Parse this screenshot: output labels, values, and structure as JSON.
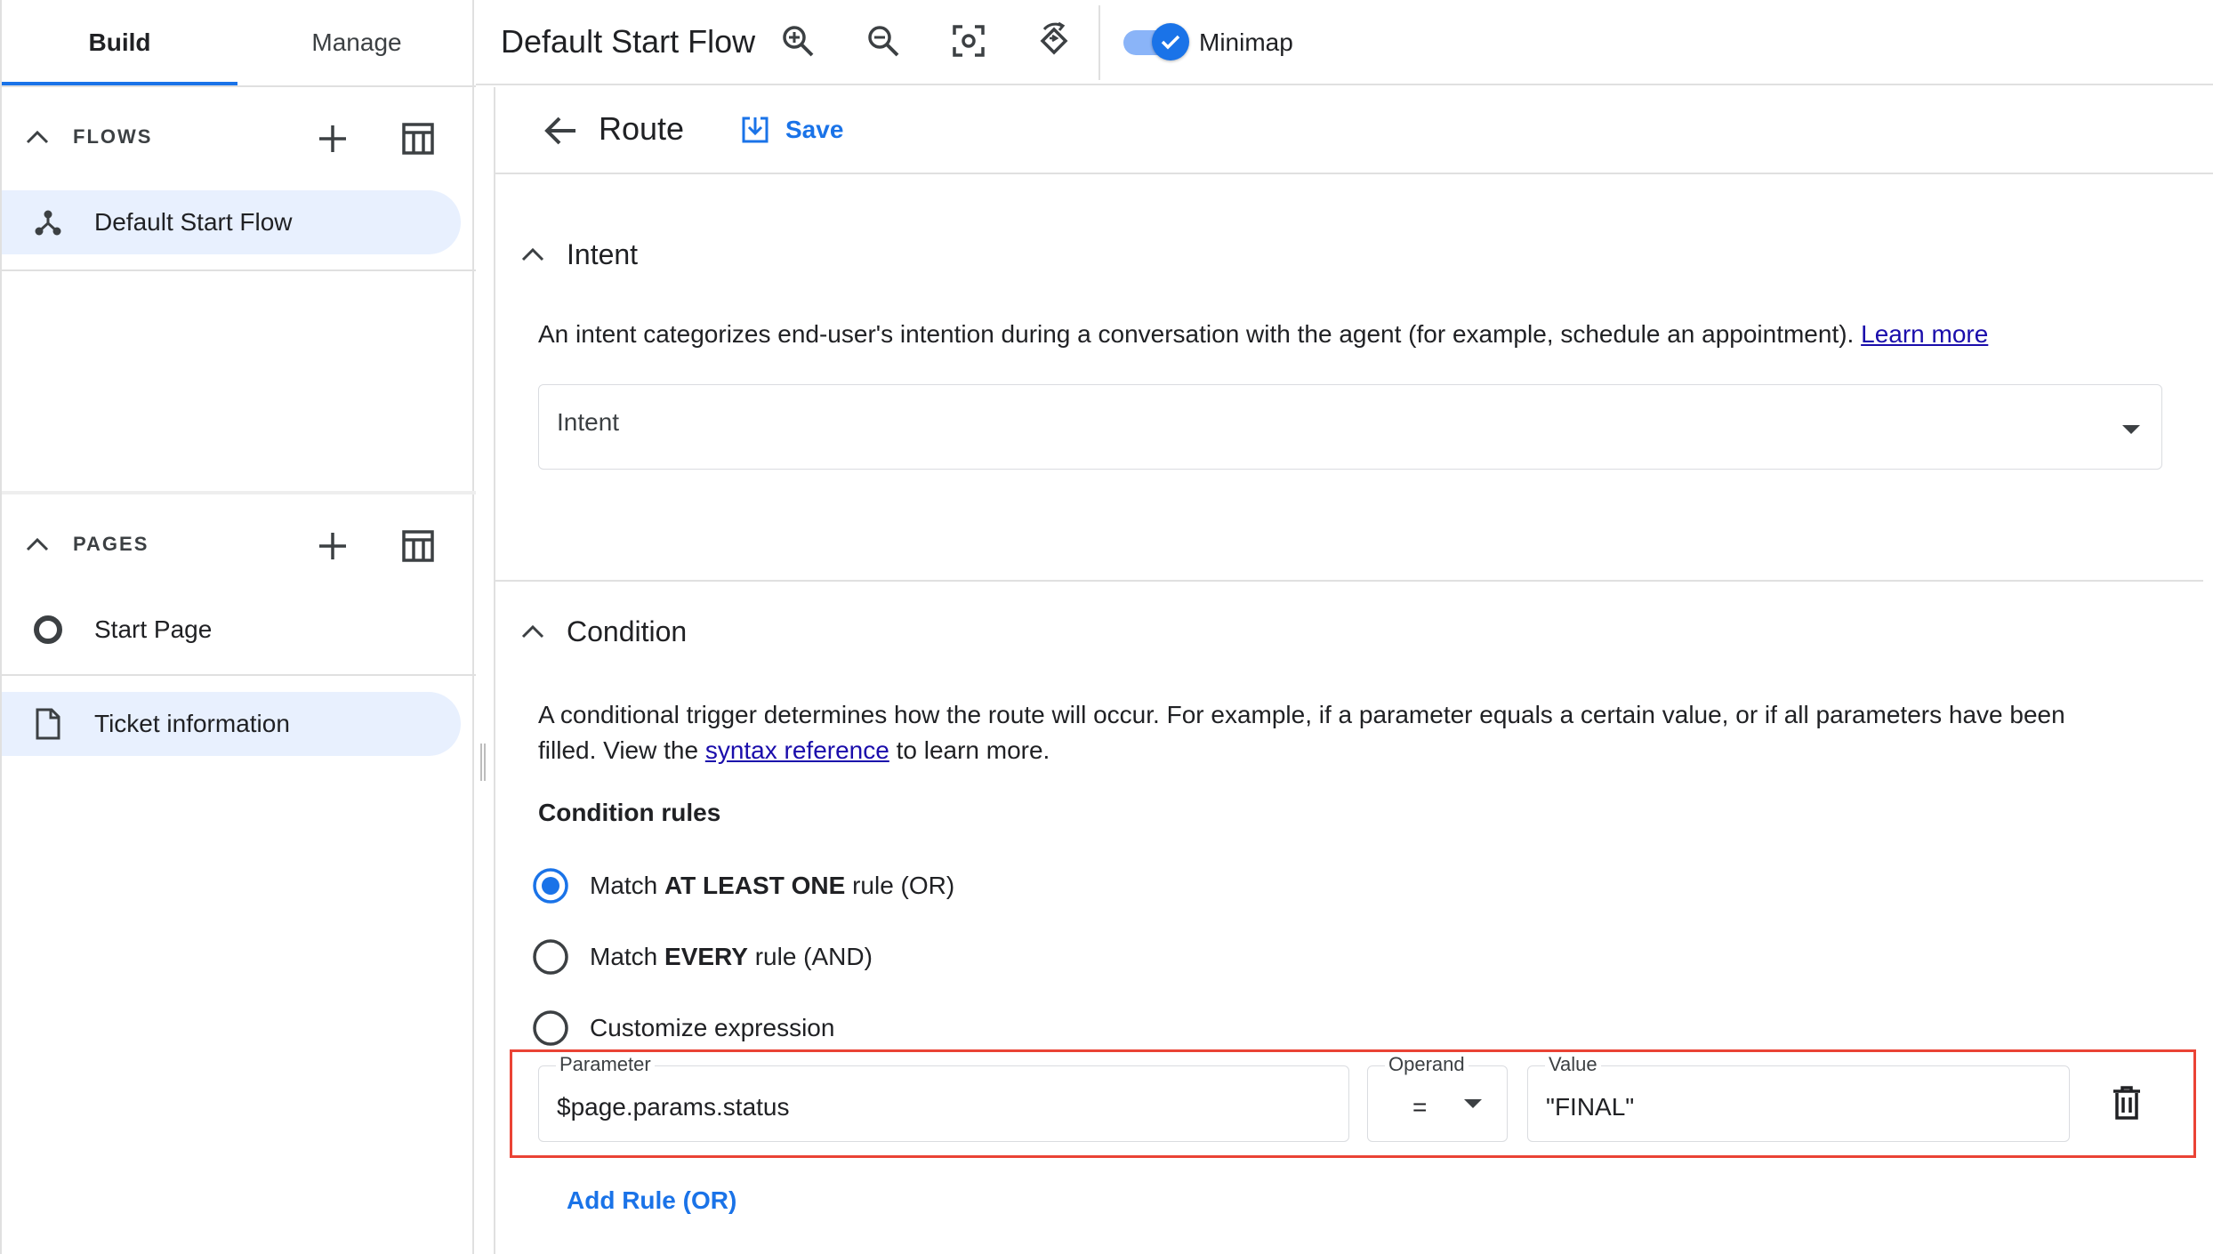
{
  "tabs": {
    "build": "Build",
    "manage": "Manage"
  },
  "toolbar": {
    "flow_title": "Default Start Flow",
    "minimap_label": "Minimap",
    "minimap_on": true,
    "icons": [
      "zoom-in-icon",
      "zoom-out-icon",
      "fit-screen-icon",
      "reset-view-icon"
    ]
  },
  "sidebar": {
    "flows": {
      "header": "FLOWS",
      "items": [
        {
          "label": "Default Start Flow",
          "icon": "flow-icon",
          "selected": true
        }
      ]
    },
    "pages": {
      "header": "PAGES",
      "items": [
        {
          "label": "Start Page",
          "icon": "start-page-icon",
          "selected": false
        },
        {
          "label": "Ticket information",
          "icon": "page-icon",
          "selected": true
        }
      ]
    }
  },
  "route": {
    "title": "Route",
    "save_label": "Save"
  },
  "intent": {
    "heading": "Intent",
    "description": "An intent categorizes end-user's intention during a conversation with the agent (for example, schedule an appointment).",
    "learn_more": "Learn more",
    "placeholder": "Intent"
  },
  "condition": {
    "heading": "Condition",
    "desc_line1": "A conditional trigger determines how the route will occur. For example, if a parameter equals a certain value, or if all parameters have been",
    "desc_line2_before": "filled. View the",
    "syntax_link": "syntax reference",
    "desc_line2_after": "to learn more.",
    "rules_heading": "Condition rules",
    "options": [
      {
        "pre": "Match",
        "bold": "AT LEAST ONE",
        "post": "rule (OR)",
        "selected": true
      },
      {
        "pre": "Match",
        "bold": "EVERY",
        "post": "rule (AND)",
        "selected": false
      },
      {
        "pre": "Customize expression",
        "bold": "",
        "post": "",
        "selected": false
      }
    ],
    "rule": {
      "parameter_label": "Parameter",
      "parameter_value": "$page.params.status",
      "operand_label": "Operand",
      "operand_value": "=",
      "value_label": "Value",
      "value_value": "\"FINAL\""
    },
    "add_rule": "Add Rule (OR)"
  },
  "colors": {
    "accent": "#1a73e8",
    "selected_bg": "#e8f0fe",
    "highlight_box": "#ea4335",
    "link": "#1a0dab"
  }
}
